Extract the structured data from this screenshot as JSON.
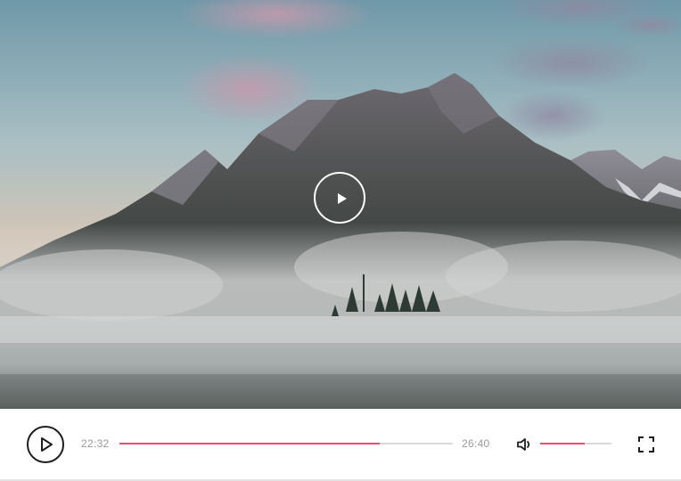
{
  "video": {
    "scene": "landscape-mountain-fog-lake",
    "center_play_icon": "play-icon"
  },
  "controls": {
    "play_icon": "play-icon",
    "current_time": "22:32",
    "total_time": "26:40",
    "progress": 0.78,
    "volume_icon": "volume-icon",
    "volume": 0.63,
    "fullscreen_icon": "fullscreen-icon"
  },
  "colors": {
    "accent": "#f04a6e",
    "track": "#d9d9d9",
    "icon": "#1f1f1f",
    "time_text": "#9a9a9a"
  }
}
